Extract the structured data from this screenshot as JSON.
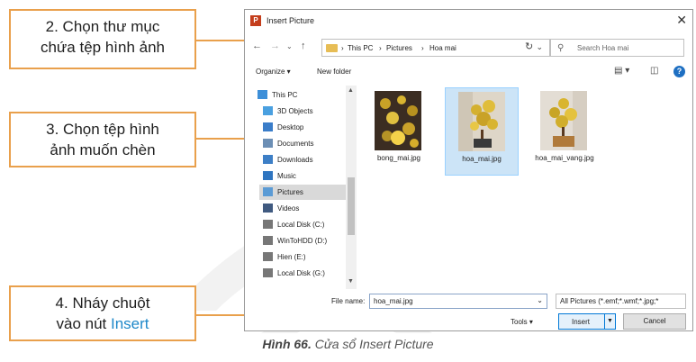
{
  "dialog": {
    "title": "Insert Picture",
    "app_icon_letter": "P",
    "breadcrumb": [
      "This PC",
      "Pictures",
      "Hoa mai"
    ],
    "search_placeholder": "Search Hoa mai",
    "toolbar": {
      "organize": "Organize ▾",
      "new_folder": "New folder"
    },
    "nav_items": [
      {
        "label": "This PC",
        "icon": "computer-icon"
      },
      {
        "label": "3D Objects",
        "icon": "cube-icon"
      },
      {
        "label": "Desktop",
        "icon": "desktop-icon"
      },
      {
        "label": "Documents",
        "icon": "documents-icon"
      },
      {
        "label": "Downloads",
        "icon": "download-icon"
      },
      {
        "label": "Music",
        "icon": "music-icon"
      },
      {
        "label": "Pictures",
        "icon": "pictures-icon",
        "selected": true
      },
      {
        "label": "Videos",
        "icon": "videos-icon"
      },
      {
        "label": "Local Disk (C:)",
        "icon": "drive-icon"
      },
      {
        "label": "WinToHDD (D:)",
        "icon": "drive-icon"
      },
      {
        "label": "Hien (E:)",
        "icon": "drive-icon"
      },
      {
        "label": "Local Disk (G:)",
        "icon": "drive-icon"
      }
    ],
    "files": [
      {
        "name": "bong_mai.jpg",
        "selected": false
      },
      {
        "name": "hoa_mai.jpg",
        "selected": true
      },
      {
        "name": "hoa_mai_vang.jpg",
        "selected": false
      }
    ],
    "file_name_label": "File name:",
    "file_name_value": "hoa_mai.jpg",
    "file_type_filter": "All Pictures (*.emf;*.wmf;*.jpg;*",
    "tools_label": "Tools",
    "insert_label": "Insert",
    "cancel_label": "Cancel"
  },
  "callouts": {
    "step2": {
      "line1": "2. Chọn thư mục",
      "line2": "chứa tệp hình ảnh"
    },
    "step3": {
      "line1": "3. Chọn tệp hình",
      "line2": "ảnh muốn chèn"
    },
    "step4": {
      "line1": "4. Nháy chuột",
      "line2_prefix": "vào nút ",
      "line2_highlight": "Insert"
    }
  },
  "caption": {
    "bold": "Hình 66.",
    "text": " Cửa sổ Insert Picture"
  },
  "colors": {
    "accent_orange": "#e9a04c",
    "highlight_blue": "#1e88c9",
    "selection_blue": "#cce4f7"
  }
}
